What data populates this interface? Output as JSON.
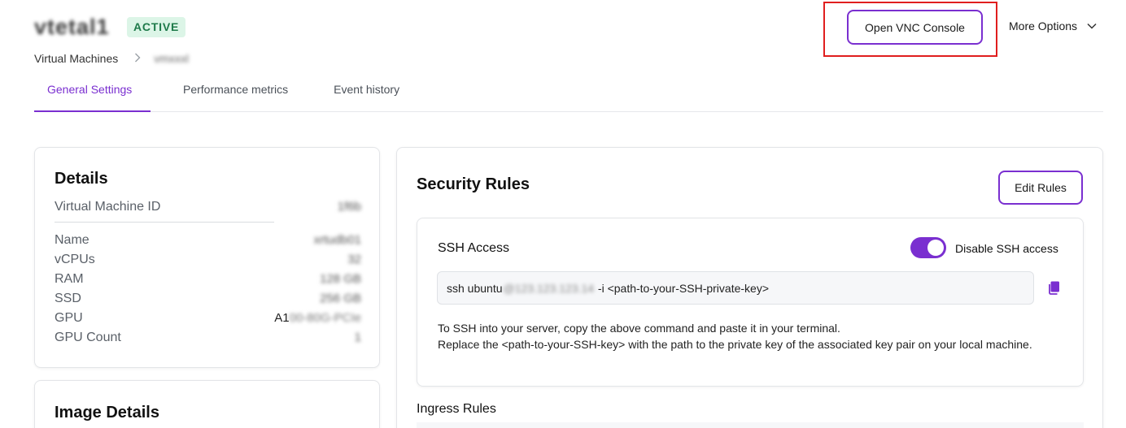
{
  "header": {
    "vm_name": "vtetal1",
    "status": "ACTIVE",
    "breadcrumb": {
      "parent": "Virtual Machines",
      "current": "vmxxxl"
    },
    "vnc_button": "Open VNC Console",
    "more_options": "More Options"
  },
  "tabs": [
    {
      "label": "General Settings",
      "active": true
    },
    {
      "label": "Performance metrics",
      "active": false
    },
    {
      "label": "Event history",
      "active": false
    }
  ],
  "details": {
    "title": "Details",
    "vm_id_label": "Virtual Machine ID",
    "vm_id_value": "1f6b",
    "rows": [
      {
        "label": "Name",
        "value": "xrtudb01"
      },
      {
        "label": "vCPUs",
        "value": "32"
      },
      {
        "label": "RAM",
        "value": "128 GB"
      },
      {
        "label": "SSD",
        "value": "256 GB"
      }
    ],
    "gpu_label": "GPU",
    "gpu_prefix": "A1",
    "gpu_rest": "00-80G-PCIe",
    "gpu_count_label": "GPU Count",
    "gpu_count_value": "1"
  },
  "image_details": {
    "title": "Image Details"
  },
  "security": {
    "title": "Security Rules",
    "edit_button": "Edit Rules",
    "ssh": {
      "title": "SSH Access",
      "toggle_label": "Disable SSH access",
      "toggle_on": true,
      "cmd_prefix": "ssh ubuntu",
      "cmd_host": "@123.123.123.14",
      "cmd_suffix": " -i <path-to-your-SSH-private-key>",
      "help_line1": "To SSH into your server, copy the above command and paste it in your terminal.",
      "help_line2": "Replace the <path-to-your-SSH-key> with the path to the private key of the associated key pair on your local machine."
    },
    "ingress_title": "Ingress Rules"
  },
  "colors": {
    "accent": "#7a2fd0",
    "status_bg": "#dcf5e7",
    "status_text": "#1e7a4a",
    "highlight": "#e01e1e"
  },
  "icons": [
    "chevron-right-icon",
    "chevron-down-icon",
    "copy-icon"
  ]
}
